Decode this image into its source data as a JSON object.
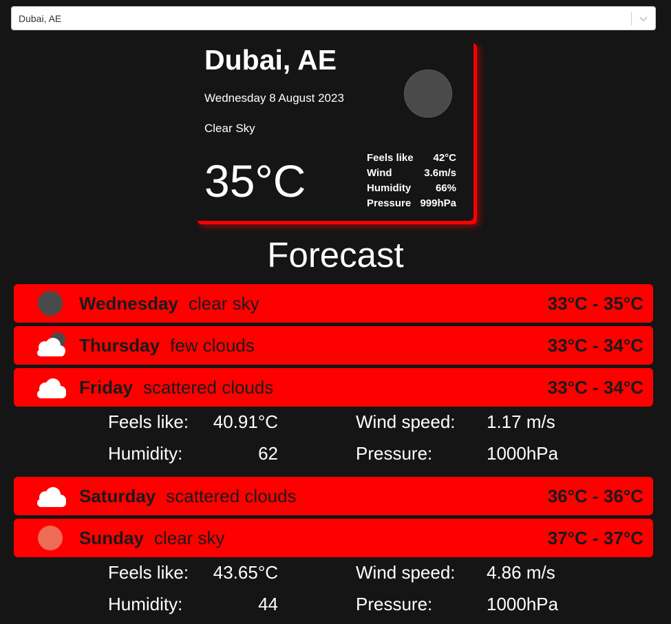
{
  "search": {
    "value": "Dubai, AE"
  },
  "current": {
    "city": "Dubai, AE",
    "date": "Wednesday 8 August 2023",
    "description": "Clear Sky",
    "temperature": "35°C",
    "icon": "moon-icon",
    "details": [
      {
        "label": "Feels like",
        "value": "42°C"
      },
      {
        "label": "Wind",
        "value": "3.6m/s"
      },
      {
        "label": "Humidity",
        "value": "66%"
      },
      {
        "label": "Pressure",
        "value": "999hPa"
      }
    ]
  },
  "forecast": {
    "title": "Forecast",
    "days": [
      {
        "name": "Wednesday",
        "description": "clear sky",
        "range": "33°C - 35°C",
        "icon": "moon-icon"
      },
      {
        "name": "Thursday",
        "description": "few clouds",
        "range": "33°C - 34°C",
        "icon": "cloud-moon-icon"
      },
      {
        "name": "Friday",
        "description": "scattered clouds",
        "range": "33°C - 34°C",
        "icon": "cloud-icon",
        "expanded": {
          "feels_like_label": "Feels like:",
          "feels_like": "40.91°C",
          "wind_label": "Wind speed:",
          "wind": "1.17 m/s",
          "humidity_label": "Humidity:",
          "humidity": "62",
          "pressure_label": "Pressure:",
          "pressure": "1000hPa"
        }
      },
      {
        "name": "Saturday",
        "description": "scattered clouds",
        "range": "36°C - 36°C",
        "icon": "cloud-icon"
      },
      {
        "name": "Sunday",
        "description": "clear sky",
        "range": "37°C - 37°C",
        "icon": "sun-icon",
        "expanded": {
          "feels_like_label": "Feels like:",
          "feels_like": "43.65°C",
          "wind_label": "Wind speed:",
          "wind": "4.86 m/s",
          "humidity_label": "Humidity:",
          "humidity": "44",
          "pressure_label": "Pressure:",
          "pressure": "1000hPa"
        }
      }
    ]
  },
  "colors": {
    "accent": "#ff0000",
    "background": "#151515",
    "sun": "#ee6b55"
  }
}
